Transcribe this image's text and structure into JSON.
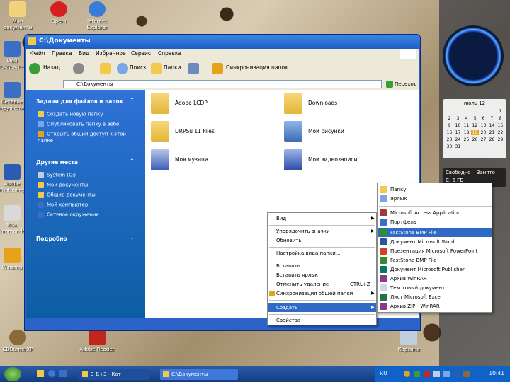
{
  "desktop": {
    "icons": [
      {
        "label": "Мои документы",
        "color": "#f2d27a"
      },
      {
        "label": "Opera",
        "color": "#d62020"
      },
      {
        "label": "Internet Explorer",
        "color": "#3a7ad9"
      },
      {
        "label": "Мой компьютер",
        "color": "#3b6fc6"
      },
      {
        "label": "Сетевое окружение",
        "color": "#3b6fc6"
      },
      {
        "label": "Adobe Photoshop",
        "color": "#2a5db0"
      },
      {
        "label": "Total Commander",
        "color": "#d9d9d9"
      },
      {
        "label": "Winamp",
        "color": "#e6a21a"
      },
      {
        "label": "Корзина",
        "color": "#bfcfe0"
      },
      {
        "label": "CDBurnerXP",
        "color": "#8a6a3a"
      },
      {
        "label": "Adobe Reader",
        "color": "#c0261c"
      }
    ]
  },
  "window": {
    "title": "C:\\Документы",
    "menu": [
      "Файл",
      "Правка",
      "Вид",
      "Избранное",
      "Сервис",
      "Справка"
    ],
    "toolbar": {
      "back": "Назад",
      "search": "Поиск",
      "folders": "Папки",
      "sync": "Синхронизация папок"
    },
    "address": {
      "value": "C:\\Документы",
      "go": "Переход"
    },
    "tasks": {
      "title": "Задачи для файлов и папок",
      "items": [
        "Создать новую папку",
        "Опубликовать папку в вебе",
        "Открыть общий доступ к этой папке"
      ]
    },
    "places": {
      "title": "Другие места",
      "items": [
        "System (C:)",
        "Мои документы",
        "Общие документы",
        "Мой компьютер",
        "Сетевое окружение"
      ]
    },
    "details": {
      "title": "Подробно"
    },
    "files": [
      {
        "name": "Adobe LCDP",
        "type": "folder"
      },
      {
        "name": "Downloads",
        "type": "folder"
      },
      {
        "name": "DRPSu 11 Files",
        "type": "folder"
      },
      {
        "name": "Мои рисунки",
        "type": "pictures"
      },
      {
        "name": "Моя музыка",
        "type": "music"
      },
      {
        "name": "Мои видеозаписи",
        "type": "video"
      }
    ]
  },
  "context_menu": {
    "items": [
      {
        "label": "Вид",
        "arrow": true
      },
      {
        "label": "Упорядочить значки",
        "arrow": true
      },
      {
        "label": "Обновить",
        "arrow": false
      },
      {
        "label": "Настройка вида папки...",
        "arrow": false
      },
      {
        "label": "Вставить",
        "arrow": false
      },
      {
        "label": "Вставить ярлык",
        "arrow": false
      },
      {
        "label": "Отменить удаление",
        "arrow": false,
        "shortcut": "CTRL+Z"
      },
      {
        "label": "Синхронизация общей папки",
        "arrow": true
      },
      {
        "label": "Создать",
        "arrow": true,
        "highlighted": true
      },
      {
        "label": "Свойства",
        "arrow": false
      }
    ]
  },
  "submenu": {
    "items": [
      {
        "label": "Папку",
        "color": "#f2c94c"
      },
      {
        "label": "Ярлык",
        "color": "#7aa6e8"
      },
      {
        "label": "Microsoft Access Application",
        "color": "#a4373a"
      },
      {
        "label": "Портфель",
        "color": "#3b6fc6"
      },
      {
        "label": "FastStone BMP File",
        "color": "#2f8f2f",
        "highlighted": true
      },
      {
        "label": "Документ Microsoft Word",
        "color": "#2b579a"
      },
      {
        "label": "Презентация Microsoft PowerPoint",
        "color": "#d04423"
      },
      {
        "label": "FastStone BMP File",
        "color": "#2f8f2f"
      },
      {
        "label": "Документ Microsoft Publisher",
        "color": "#077568"
      },
      {
        "label": "Архив WinRAR",
        "color": "#8a3a8a"
      },
      {
        "label": "Текстовый документ",
        "color": "#cfd8e3"
      },
      {
        "label": "Лист Microsoft Excel",
        "color": "#217346"
      },
      {
        "label": "Архив ZIP - WinRAR",
        "color": "#8a3a8a"
      }
    ]
  },
  "sidebar": {
    "calendar": {
      "month": "июль 12",
      "days": [
        "1",
        "2",
        "3",
        "4",
        "5",
        "6",
        "7",
        "8",
        "9",
        "10",
        "11",
        "12",
        "13",
        "14",
        "15",
        "16",
        "17",
        "18",
        "19",
        "20",
        "21",
        "22",
        "23",
        "24",
        "25",
        "26",
        "27",
        "28",
        "29",
        "30",
        "31"
      ],
      "today": "19"
    },
    "disk": {
      "free_label": "Свободно",
      "busy_label": "Занято",
      "drive": "C: 5 ГБ"
    }
  },
  "taskbar": {
    "tasks": [
      "3 Д+3 - Кот",
      "C:\\Документы"
    ],
    "lang": "RU",
    "clock": "10:41"
  }
}
